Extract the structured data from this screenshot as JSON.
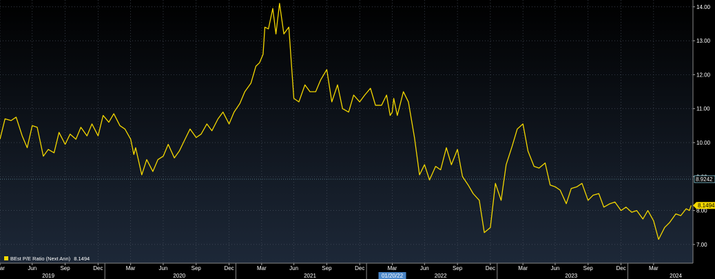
{
  "chart_data": {
    "type": "line",
    "title": "",
    "xlabel": "",
    "ylabel": "",
    "ylim": [
      6.45,
      14.2
    ],
    "xlim": [
      "2018-12-01",
      "2024-03-20"
    ],
    "y_ticks": [
      "7.00",
      "8.00",
      "9.00",
      "10.00",
      "11.00",
      "12.00",
      "13.00",
      "14.00"
    ],
    "month_ticks": [
      {
        "date": "2018-12-01",
        "label": "Mar"
      },
      {
        "date": "2019-03-01",
        "label": "Jun"
      },
      {
        "date": "2019-06-01",
        "label": "Sep"
      },
      {
        "date": "2019-09-01",
        "label": "Dec"
      },
      {
        "date": "2019-12-01",
        "label": "Mar"
      },
      {
        "date": "2020-03-01",
        "label": "Jun"
      },
      {
        "date": "2020-06-01",
        "label": "Sep"
      },
      {
        "date": "2020-09-01",
        "label": "Dec"
      },
      {
        "date": "2020-12-01",
        "label": "Mar"
      },
      {
        "date": "2021-03-01",
        "label": "Jun"
      },
      {
        "date": "2021-06-01",
        "label": "Sep"
      },
      {
        "date": "2021-09-01",
        "label": "Dec"
      },
      {
        "date": "2021-12-01",
        "label": "Mar"
      },
      {
        "date": "2022-03-01",
        "label": "Jun"
      },
      {
        "date": "2022-06-01",
        "label": "Sep"
      },
      {
        "date": "2022-09-01",
        "label": "Dec"
      },
      {
        "date": "2022-12-01",
        "label": "Mar"
      },
      {
        "date": "2023-03-01",
        "label": "Jun"
      },
      {
        "date": "2023-06-01",
        "label": "Sep"
      },
      {
        "date": "2023-09-01",
        "label": "Dec"
      },
      {
        "date": "2023-12-01",
        "label": "Mar"
      }
    ],
    "year_labels": [
      {
        "date": "2019-04-15",
        "label": "2019"
      },
      {
        "date": "2020-04-15",
        "label": "2020"
      },
      {
        "date": "2021-04-15",
        "label": "2021"
      },
      {
        "date": "2022-04-15",
        "label": "2022"
      },
      {
        "date": "2023-04-15",
        "label": "2023"
      },
      {
        "date": "2024-02-01",
        "label": "2024"
      }
    ],
    "year_dividers": [
      "2019-09-20",
      "2020-09-20",
      "2021-09-20",
      "2022-09-20",
      "2023-09-20"
    ],
    "highlighted_date": {
      "date": "2021-12-01",
      "label": "01/20/22",
      "color": "#4a86c8"
    },
    "series": [
      {
        "name": "BEst P/E Ratio (Next Ann)",
        "last_value": "8.1494",
        "color": "#f5d800",
        "x": [
          "2018-12-01",
          "2018-12-15",
          "2019-01-01",
          "2019-01-15",
          "2019-02-01",
          "2019-02-15",
          "2019-03-01",
          "2019-03-15",
          "2019-04-01",
          "2019-04-15",
          "2019-05-01",
          "2019-05-15",
          "2019-06-01",
          "2019-06-15",
          "2019-07-01",
          "2019-07-15",
          "2019-08-01",
          "2019-08-15",
          "2019-09-01",
          "2019-09-15",
          "2019-10-01",
          "2019-10-15",
          "2019-11-01",
          "2019-11-15",
          "2019-12-01",
          "2019-12-10",
          "2019-12-15",
          "2020-01-01",
          "2020-01-15",
          "2020-02-01",
          "2020-02-15",
          "2020-03-01",
          "2020-03-15",
          "2020-04-01",
          "2020-04-15",
          "2020-05-01",
          "2020-05-15",
          "2020-06-01",
          "2020-06-15",
          "2020-07-01",
          "2020-07-15",
          "2020-08-01",
          "2020-08-15",
          "2020-09-01",
          "2020-09-15",
          "2020-10-01",
          "2020-10-15",
          "2020-11-01",
          "2020-11-15",
          "2020-11-25",
          "2020-12-05",
          "2020-12-10",
          "2020-12-20",
          "2021-01-01",
          "2021-01-10",
          "2021-01-20",
          "2021-02-01",
          "2021-02-15",
          "2021-03-01",
          "2021-03-15",
          "2021-04-01",
          "2021-04-15",
          "2021-05-01",
          "2021-05-15",
          "2021-06-01",
          "2021-06-15",
          "2021-07-01",
          "2021-07-15",
          "2021-08-01",
          "2021-08-15",
          "2021-09-01",
          "2021-09-15",
          "2021-10-01",
          "2021-10-15",
          "2021-11-01",
          "2021-11-15",
          "2021-11-25",
          "2021-12-01",
          "2021-12-05",
          "2021-12-15",
          "2022-01-01",
          "2022-01-15",
          "2022-02-01",
          "2022-02-15",
          "2022-03-01",
          "2022-03-15",
          "2022-04-01",
          "2022-04-15",
          "2022-05-01",
          "2022-05-15",
          "2022-06-01",
          "2022-06-15",
          "2022-07-01",
          "2022-07-15",
          "2022-08-01",
          "2022-08-15",
          "2022-09-01",
          "2022-09-15",
          "2022-10-01",
          "2022-10-15",
          "2022-11-01",
          "2022-11-15",
          "2022-12-01",
          "2022-12-15",
          "2023-01-01",
          "2023-01-15",
          "2023-02-01",
          "2023-02-15",
          "2023-03-01",
          "2023-03-15",
          "2023-04-01",
          "2023-04-15",
          "2023-05-01",
          "2023-05-15",
          "2023-06-01",
          "2023-06-15",
          "2023-07-01",
          "2023-07-15",
          "2023-08-01",
          "2023-08-15",
          "2023-09-01",
          "2023-09-15",
          "2023-10-01",
          "2023-10-15",
          "2023-11-01",
          "2023-11-15",
          "2023-12-01",
          "2023-12-15",
          "2024-01-01",
          "2024-01-15",
          "2024-02-01",
          "2024-02-15",
          "2024-03-01",
          "2024-03-10",
          "2024-03-15"
        ],
        "y": [
          10.1,
          10.7,
          10.65,
          10.75,
          10.2,
          9.85,
          10.5,
          10.45,
          9.6,
          9.8,
          9.7,
          10.3,
          9.95,
          10.25,
          10.1,
          10.45,
          10.2,
          10.55,
          10.2,
          10.8,
          10.6,
          10.85,
          10.5,
          10.4,
          10.1,
          9.65,
          9.85,
          9.05,
          9.5,
          9.15,
          9.5,
          9.6,
          9.95,
          9.55,
          9.75,
          10.1,
          10.4,
          10.15,
          10.25,
          10.55,
          10.35,
          10.7,
          10.9,
          10.55,
          10.9,
          11.15,
          11.5,
          11.75,
          12.25,
          12.35,
          12.6,
          13.4,
          13.35,
          13.95,
          13.2,
          14.1,
          13.2,
          13.4,
          11.3,
          11.2,
          11.7,
          11.5,
          11.5,
          11.85,
          12.15,
          11.2,
          11.7,
          11.0,
          10.9,
          11.4,
          11.2,
          11.4,
          11.6,
          11.1,
          11.1,
          11.4,
          10.8,
          10.9,
          11.3,
          10.8,
          11.5,
          11.2,
          10.15,
          9.05,
          9.35,
          8.9,
          9.3,
          9.2,
          9.85,
          9.35,
          9.8,
          9.0,
          8.75,
          8.5,
          8.3,
          7.35,
          7.5,
          8.8,
          8.3,
          9.35,
          9.9,
          10.4,
          10.55,
          9.75,
          9.3,
          9.25,
          9.4,
          8.75,
          8.7,
          8.6,
          8.2,
          8.65,
          8.7,
          8.8,
          8.3,
          8.45,
          8.5,
          8.1,
          8.2,
          8.25,
          8.0,
          8.1,
          7.95,
          8.0,
          7.75,
          8.0,
          7.7,
          7.15,
          7.5,
          7.65,
          7.9,
          7.85,
          8.05,
          8.0,
          8.1494
        ]
      }
    ],
    "reference_lines": [
      {
        "value": 8.9242,
        "label": "8.9242",
        "color": "#8fd6e8",
        "style": "dotted"
      }
    ],
    "legend_position": "bottom-left",
    "grid": true
  }
}
